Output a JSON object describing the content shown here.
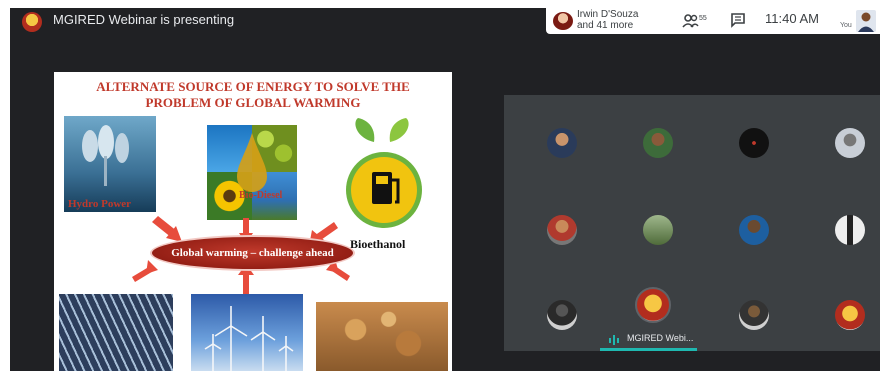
{
  "topbar": {
    "presenting_text": "MGIRED Webinar is presenting"
  },
  "participants_pill": {
    "line1": "Irwin D'Souza",
    "line2": "and 41 more"
  },
  "controls": {
    "people_count": "55",
    "time": "11:40 AM",
    "you_label": "You"
  },
  "slide": {
    "title_line1": "ALTERNATE SOURCE OF ENERGY TO SOLVE THE",
    "title_line2": "PROBLEM OF GLOBAL WARMING",
    "hydro_label": "Hydro Power",
    "biodiesel_label": "Bio-Diesel",
    "bioethanol_label": "Bioethanol",
    "center_label": "Global warming – challenge ahead"
  },
  "presenter_tile": {
    "name": "MGIRED Webi..."
  },
  "colors": {
    "accent": "#1fb8b0",
    "slide_red": "#c0392b",
    "background": "#202124"
  }
}
